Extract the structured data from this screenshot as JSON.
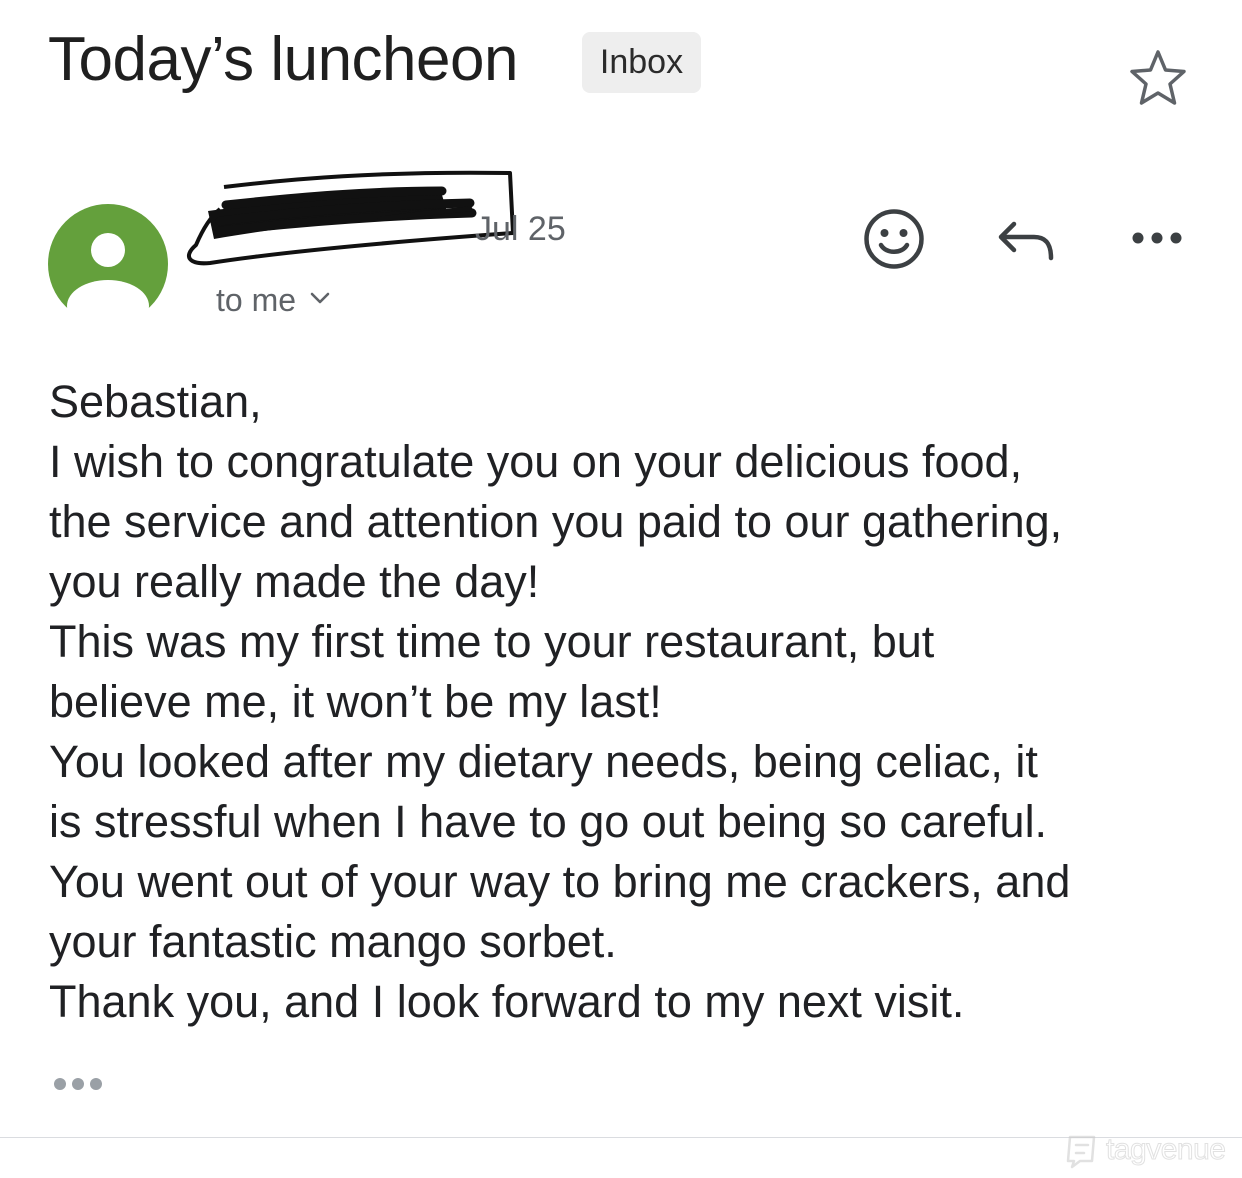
{
  "email": {
    "subject": "Today’s luncheon",
    "label": "Inbox",
    "date": "Jul 25",
    "recipients": "to me",
    "body_lines": [
      "Sebastian,",
      "I wish to congratulate you on your delicious food,",
      "the service and attention you paid to our gathering,",
      "you really made the day!",
      "This was my first time to your restaurant, but",
      "believe me, it won’t be my last!",
      "You looked after my dietary needs, being celiac, it",
      "is stressful when I have to go out being so careful.",
      "You went out of your way to bring me crackers, and",
      "your fantastic mango sorbet.",
      "Thank you, and I look forward to my next visit."
    ]
  },
  "icons": {
    "star": "star-outline-icon",
    "avatar": "person-avatar-icon",
    "emoji": "smiley-icon",
    "reply": "reply-arrow-icon",
    "more": "more-horizontal-icon",
    "expand": "chevron-down-icon",
    "trimmed": "show-trimmed-content-icon"
  },
  "colors": {
    "avatar_bg": "#64a03c",
    "label_chip_bg": "#eeeeee",
    "icon_gray": "#5f6368",
    "text": "#202124"
  },
  "watermark": {
    "text": "tagvenue"
  }
}
